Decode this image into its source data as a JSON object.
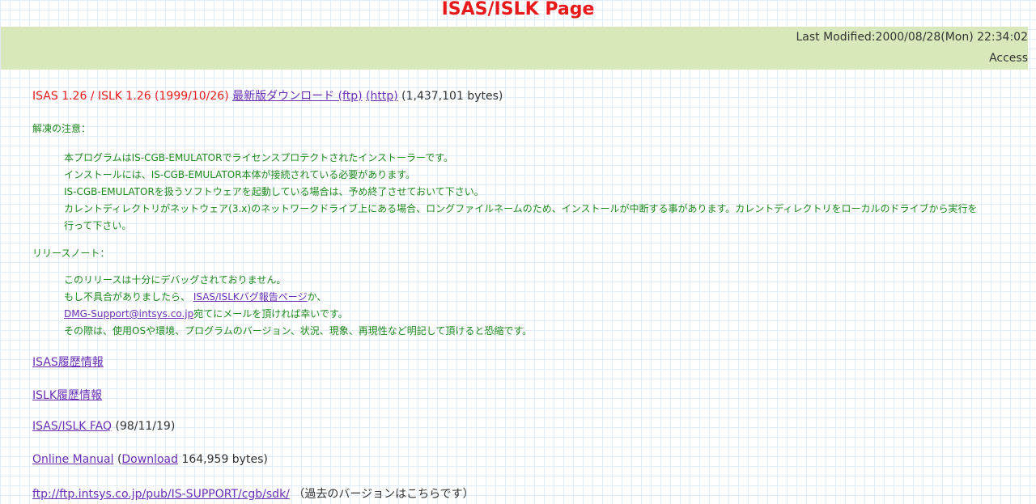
{
  "header": {
    "title": "ISAS/ISLK Page",
    "last_modified": "Last Modified:2000/08/28(Mon) 22:34:02",
    "access_label": "Access"
  },
  "release": {
    "version_text": "ISAS 1.26 / ISLK 1.26 (1999/10/26)",
    "download_ftp_label": "最新版ダウンロード (ftp)",
    "download_http_label": "(http)",
    "size_text": "(1,437,101 bytes)"
  },
  "unpack_notes": {
    "heading": "解凍の注意：",
    "lines": [
      "本プログラムはIS-CGB-EMULATORでライセンスプロテクトされたインストーラーです。",
      "インストールには、IS-CGB-EMULATOR本体が接続されている必要があります。",
      "IS-CGB-EMULATORを扱うソフトウェアを起動している場合は、予め終了させておいて下さい。",
      "カレントディレクトリがネットウェア(3.x)のネットワークドライブ上にある場合、ロングファイルネームのため、インストールが中断する事があります。カレントディレクトリをローカルのドライブから実行を",
      "行って下さい。"
    ]
  },
  "release_notes": {
    "heading": "リリースノート：",
    "line1": "このリリースは十分にデバッグされておりません。",
    "line2_prefix": "もし不具合がありましたら、",
    "bug_report_link": "ISAS/ISLKバグ報告ページ",
    "line2_suffix": "か、",
    "support_email_link": "DMG-Support@intsys.co.jp",
    "line3_suffix": "宛てにメールを頂ければ幸いです。",
    "line4": "その際は、使用OSや環境、プログラムのバージョン、状況、現象、再現性など明記して頂けると恐縮です。"
  },
  "links": {
    "isas_history": "ISAS履歴情報",
    "islk_history": "ISLK履歴情報",
    "faq": "ISAS/ISLK FAQ",
    "faq_date": "(98/11/19)",
    "manual": "Online Manual",
    "manual_open_paren": "(",
    "manual_download": "Download",
    "manual_size": "164,959 bytes)",
    "ftp_sdk": "ftp://ftp.intsys.co.jp/pub/IS-SUPPORT/cgb/sdk/",
    "ftp_sdk_note": "（過去のバージョンはこちらです）"
  },
  "colors": {
    "title_red": "#e8191a",
    "header_band": "#d9e8bb",
    "body_green": "#1e8a1e",
    "link_purple": "#6a2fb5"
  }
}
